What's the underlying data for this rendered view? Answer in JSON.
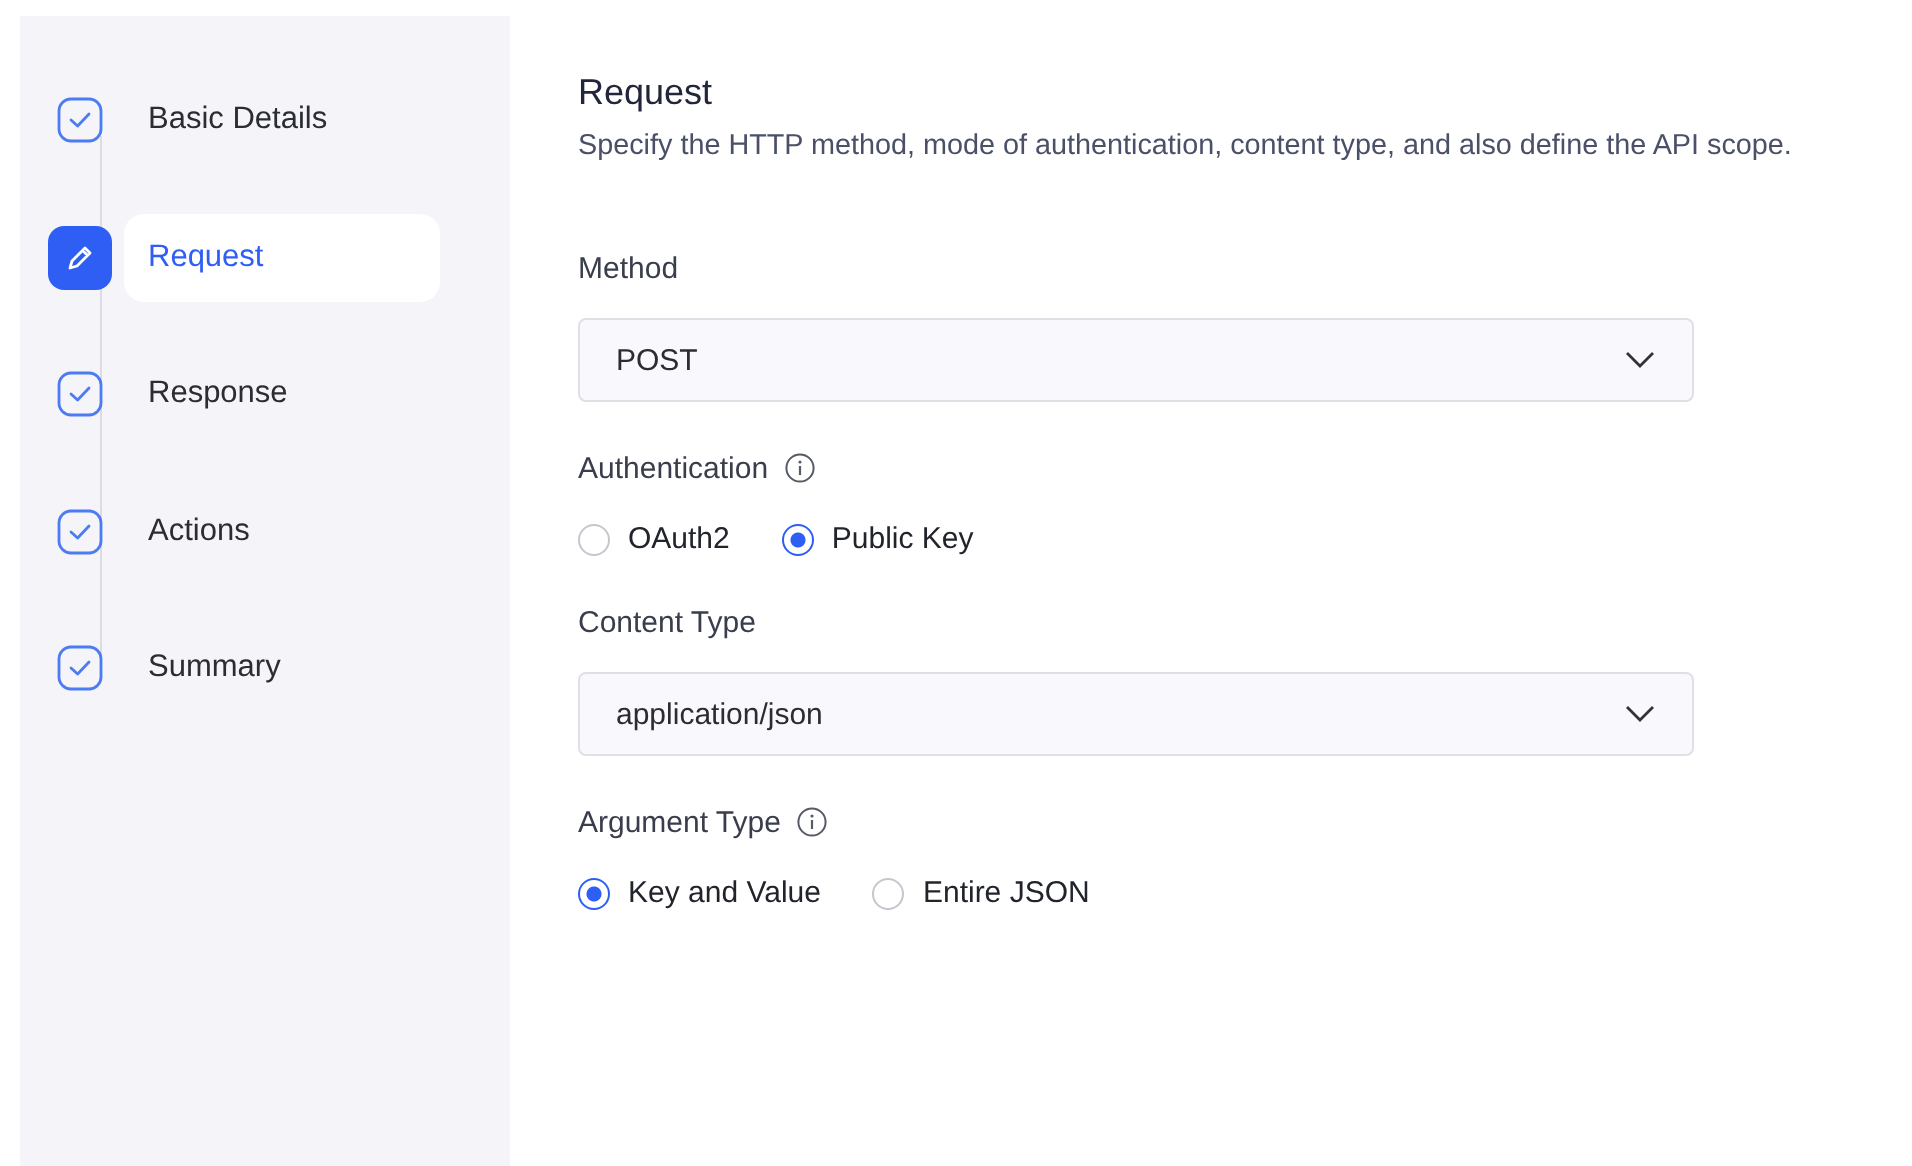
{
  "steps": [
    {
      "label": "Basic Details",
      "selected": false
    },
    {
      "label": "Request",
      "selected": true
    },
    {
      "label": "Response",
      "selected": false
    },
    {
      "label": "Actions",
      "selected": false
    },
    {
      "label": "Summary",
      "selected": false
    }
  ],
  "section": {
    "title": "Request",
    "description": "Specify the HTTP method, mode of authentication, content type, and also define the API scope."
  },
  "fields": [
    {
      "kind": "select",
      "label": "Method",
      "info": false,
      "value": "POST"
    },
    {
      "kind": "radio",
      "label": "Authentication",
      "info": true,
      "options": [
        {
          "label": "OAuth2",
          "selected": false
        },
        {
          "label": "Public Key",
          "selected": true
        }
      ]
    },
    {
      "kind": "select",
      "label": "Content Type",
      "info": false,
      "value": "application/json"
    },
    {
      "kind": "radio",
      "label": "Argument Type",
      "info": true,
      "options": [
        {
          "label": "Key and Value",
          "selected": true
        },
        {
          "label": "Entire JSON",
          "selected": false
        }
      ]
    }
  ]
}
